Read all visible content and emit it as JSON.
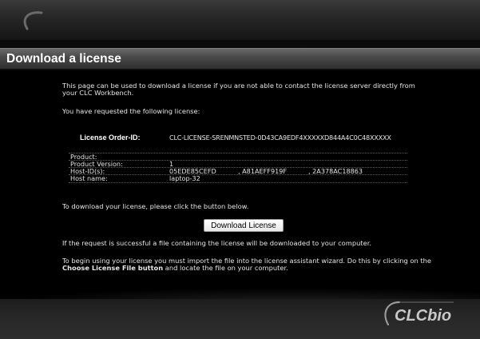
{
  "page": {
    "title": "Download a license"
  },
  "intro": {
    "line1": "This page can be used to download a license if you are not able to contact the license server directly from",
    "line2": "your CLC Workbench.",
    "requested": "You have requested the following license:"
  },
  "license": {
    "order_id_label": "License Order-ID:",
    "order_id_value": "CLC-LICENSE-SRENMNSTED-0D43CA9EDF4XXXXXD844A4C0C48XXXXX",
    "product_label": "Product:",
    "product_value": "",
    "version_label": "Product Version:",
    "version_value": "1",
    "hostid_label": "Host-ID(s):",
    "hostid_values": [
      "05EDE85CEFD",
      ", A81AEFF919F",
      ", 2A378AC18863"
    ],
    "hostname_label": "Host name:",
    "hostname_value": "laptop-32"
  },
  "instructions": {
    "click_button": "To download your license, please click the button below.",
    "download_button": "Download License",
    "success": "If the request is successful a file containing the license will be downloaded to your computer.",
    "import_line1": "To begin using your license you must import the file into the license assistant wizard. Do this by clicking on the",
    "import_bold": "Choose License File button",
    "import_rest": " and locate the file on your computer."
  },
  "brand": {
    "logo_text": "CLCbio",
    "accent": "#c8c8c8"
  }
}
